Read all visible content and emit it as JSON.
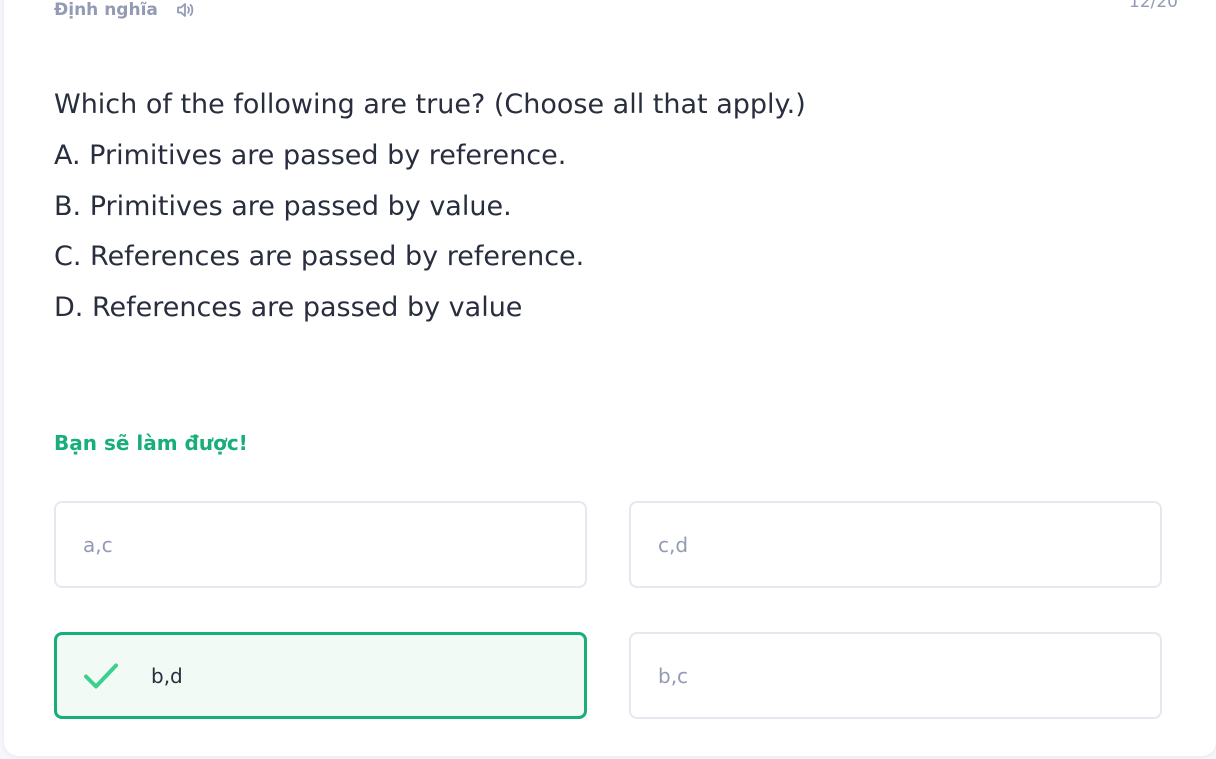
{
  "header": {
    "label": "Định nghĩa",
    "counter": "12/20"
  },
  "question": {
    "prompt": "Which of the following are true? (Choose all that apply.)",
    "options": [
      "A. Primitives are passed by reference.",
      "B. Primitives are passed by value.",
      "C. References are passed by reference.",
      "D. References are passed by value"
    ]
  },
  "feedback": {
    "message": "Bạn sẽ làm được!"
  },
  "answers": [
    {
      "label": "a,c",
      "correct": false
    },
    {
      "label": "c,d",
      "correct": false
    },
    {
      "label": "b,d",
      "correct": true
    },
    {
      "label": "b,c",
      "correct": false
    }
  ],
  "colors": {
    "accent_green": "#18ae79",
    "muted_text": "#939bb4",
    "body_text": "#282e3e",
    "border": "#e5e8ef"
  },
  "icons": {
    "audio": "speaker-icon",
    "correct": "checkmark-icon"
  }
}
